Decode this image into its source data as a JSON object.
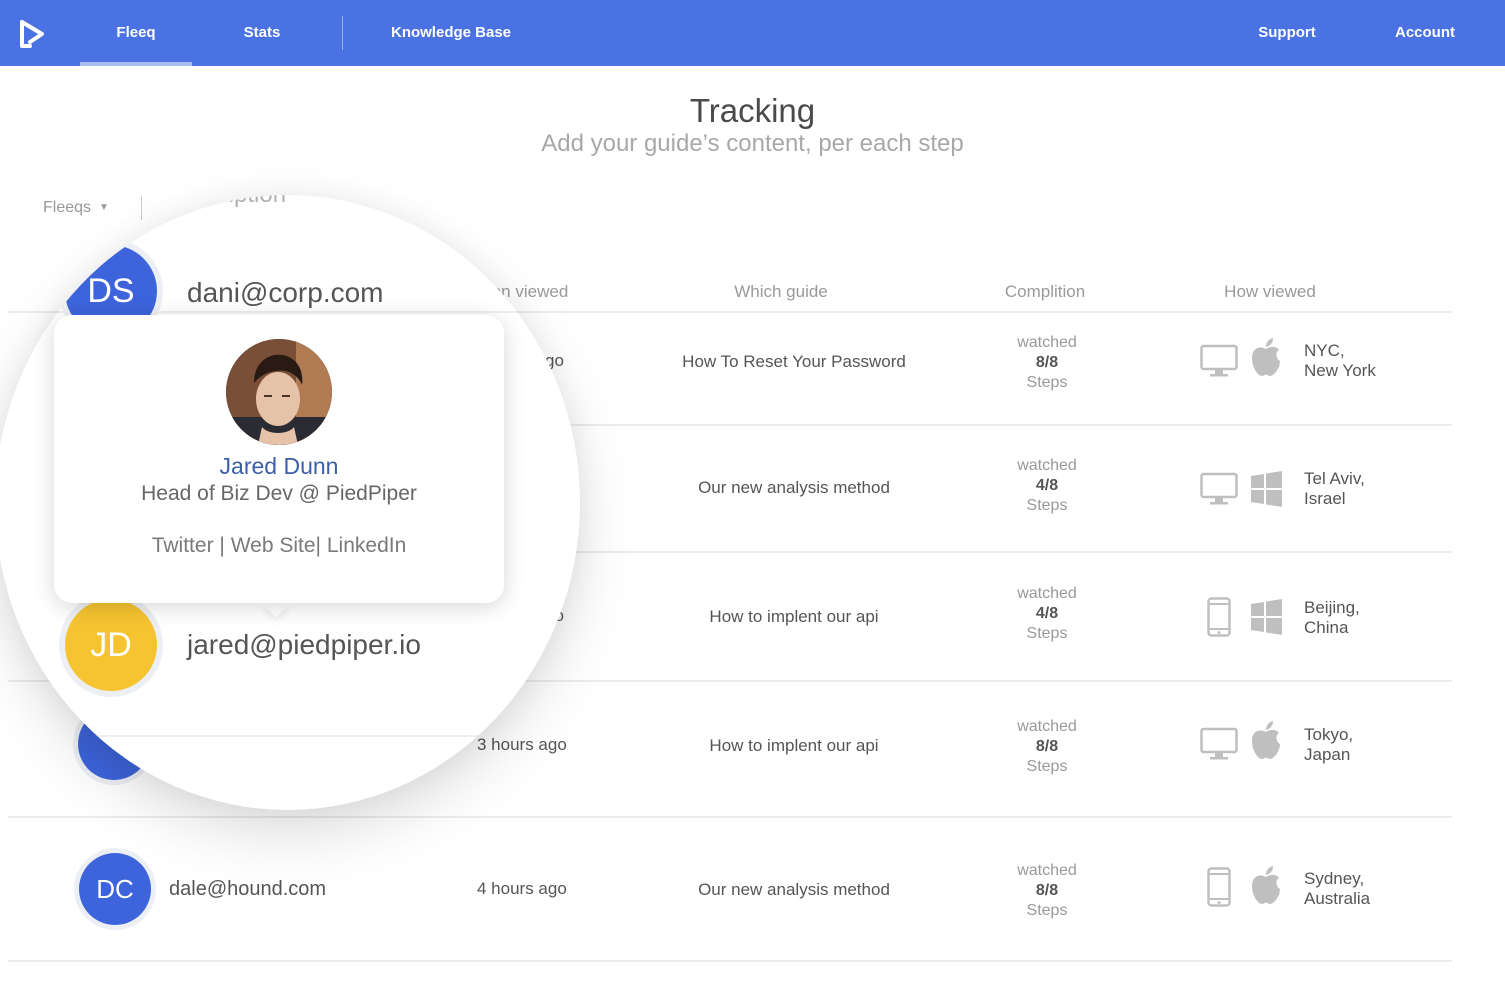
{
  "nav": {
    "items": [
      {
        "label": "Fleeq",
        "active": true
      },
      {
        "label": "Stats",
        "active": false
      },
      {
        "label": "Knowledge Base",
        "active": false
      }
    ],
    "right": [
      {
        "label": "Support"
      },
      {
        "label": "Account"
      }
    ],
    "accent": "#4a72e3"
  },
  "header": {
    "title": "Tracking",
    "subtitle": "Add your guide’s content, per each step"
  },
  "filter": {
    "label": "Fleeqs",
    "search_placeholder": "description"
  },
  "table": {
    "columns": [
      "en viewed",
      "Which guide",
      "Complition",
      "How viewed"
    ],
    "rows": [
      {
        "initials": "DS",
        "email": "dani@corp.com",
        "when": "go",
        "guide": "How To Reset Your Password",
        "status": "watched",
        "fraction": "8/8",
        "steps": "Steps",
        "device": "desktop-icon",
        "os": "apple-icon",
        "city": "NYC,",
        "country": "New York"
      },
      {
        "initials": "",
        "email": "",
        "when": "",
        "guide": "Our new analysis method",
        "status": "watched",
        "fraction": "4/8",
        "steps": "Steps",
        "device": "desktop-icon",
        "os": "windows-icon",
        "city": "Tel Aviv,",
        "country": "Israel"
      },
      {
        "initials": "JD",
        "email": "jared@piedpiper.io",
        "when": "go",
        "guide": "How to implent our api",
        "status": "watched",
        "fraction": "4/8",
        "steps": "Steps",
        "device": "mobile-icon",
        "os": "windows-icon",
        "city": "Beijing,",
        "country": "China"
      },
      {
        "initials": "",
        "email": "",
        "when": "3 hours ago",
        "guide": "How to implent our api",
        "status": "watched",
        "fraction": "8/8",
        "steps": "Steps",
        "device": "desktop-icon",
        "os": "apple-icon",
        "city": "Tokyo,",
        "country": "Japan"
      },
      {
        "initials": "DC",
        "email": "dale@hound.com",
        "when": "4 hours ago",
        "guide": "Our new analysis method",
        "status": "watched",
        "fraction": "8/8",
        "steps": "Steps",
        "device": "mobile-icon",
        "os": "apple-icon",
        "city": "Sydney,",
        "country": "Australia"
      }
    ]
  },
  "popup": {
    "name": "Jared Dunn",
    "role": "Head of Biz Dev @ PiedPiper",
    "links": [
      "Twitter",
      "Web Site",
      "LinkedIn"
    ],
    "separator": "|"
  },
  "colors": {
    "avatar_blue": "#3d64db",
    "avatar_yellow": "#f6c431",
    "name_blue": "#3c5fa8"
  }
}
